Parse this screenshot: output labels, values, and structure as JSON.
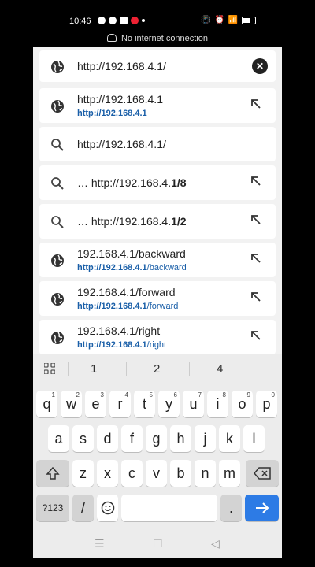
{
  "status": {
    "time": "10:46",
    "offline_text": "No internet connection"
  },
  "urlbar": {
    "value": "http://192.168.4.1/"
  },
  "suggestions": [
    {
      "icon": "globe-icon",
      "title": "http://192.168.4.1",
      "sub_bold": "http://192.168.4.1",
      "sub_rest": "",
      "arrow": true
    },
    {
      "icon": "search-icon",
      "title": "http://192.168.4.1/",
      "arrow": false
    },
    {
      "icon": "search-icon",
      "title_prefix": "… http://192.168.4.",
      "title_bold": "1/8",
      "arrow": true
    },
    {
      "icon": "search-icon",
      "title_prefix": "… http://192.168.4.",
      "title_bold": "1/2",
      "arrow": true
    },
    {
      "icon": "globe-icon",
      "title": "192.168.4.1/backward",
      "sub_bold": "http://192.168.4.1",
      "sub_rest": "/backward",
      "arrow": true
    },
    {
      "icon": "globe-icon",
      "title": "192.168.4.1/forward",
      "sub_bold": "http://192.168.4.1",
      "sub_rest": "/forward",
      "arrow": true
    },
    {
      "icon": "globe-icon",
      "title": "192.168.4.1/right",
      "sub_bold": "http://192.168.4.1",
      "sub_rest": "/right",
      "arrow": true
    }
  ],
  "keyboard": {
    "predictions": [
      "1",
      "2",
      "4"
    ],
    "row1": [
      {
        "k": "q",
        "s": "1"
      },
      {
        "k": "w",
        "s": "2"
      },
      {
        "k": "e",
        "s": "3"
      },
      {
        "k": "r",
        "s": "4"
      },
      {
        "k": "t",
        "s": "5"
      },
      {
        "k": "y",
        "s": "6"
      },
      {
        "k": "u",
        "s": "7"
      },
      {
        "k": "i",
        "s": "8"
      },
      {
        "k": "o",
        "s": "9"
      },
      {
        "k": "p",
        "s": "0"
      }
    ],
    "row2": [
      "a",
      "s",
      "d",
      "f",
      "g",
      "h",
      "j",
      "k",
      "l"
    ],
    "row3": [
      "z",
      "x",
      "c",
      "v",
      "b",
      "n",
      "m"
    ],
    "symbols_label": "?123",
    "slash_label": "/",
    "period_label": "."
  }
}
